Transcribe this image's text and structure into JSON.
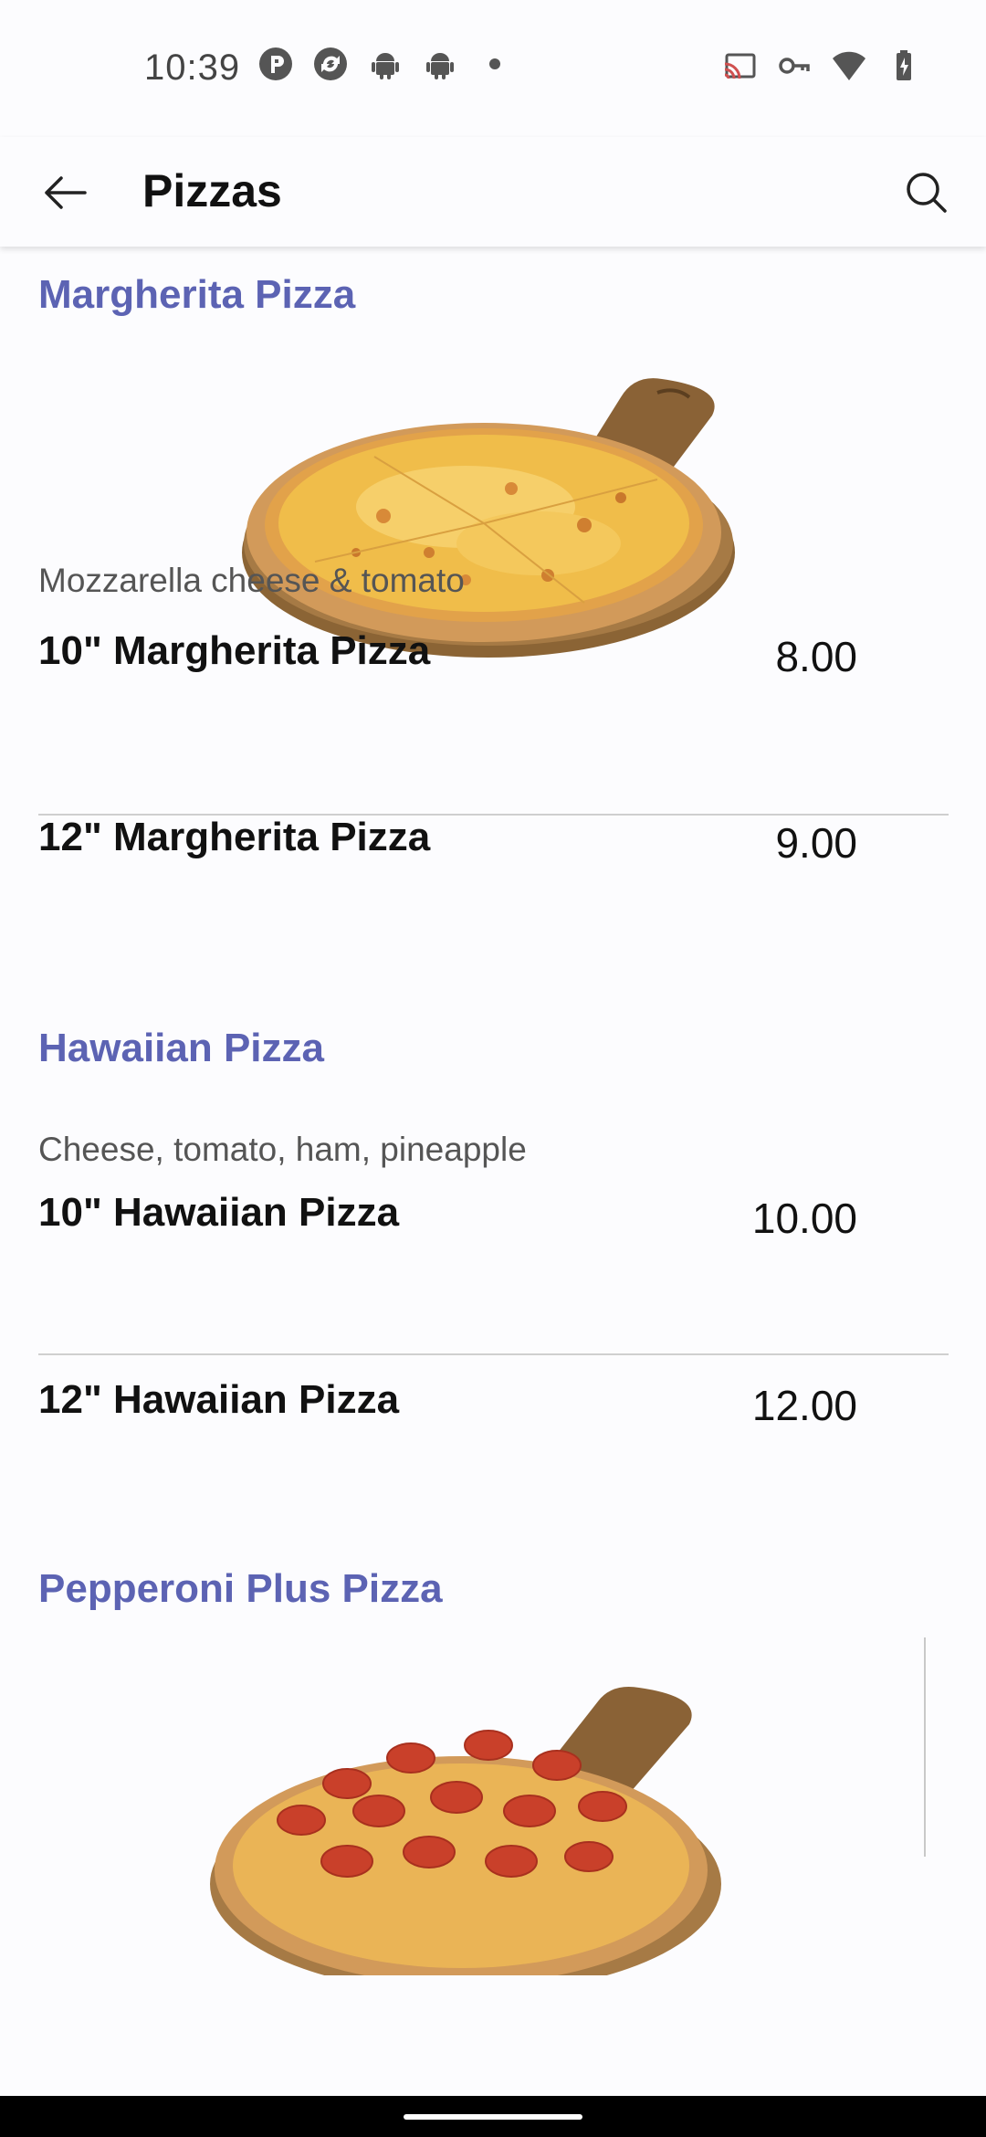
{
  "status_bar": {
    "time": "10:39",
    "left_icons": [
      "app-p-icon",
      "sync-app-icon",
      "android-icon",
      "android-icon",
      "dot-icon"
    ],
    "right_icons": [
      "cast-icon",
      "key-icon",
      "wifi-icon",
      "battery-charging-icon"
    ]
  },
  "app_bar": {
    "title": "Pizzas",
    "back_icon": "arrow-left-icon",
    "search_icon": "search-icon"
  },
  "sections": [
    {
      "title": "Margherita Pizza",
      "description": "Mozzarella cheese & tomato",
      "items": [
        {
          "name": "10\" Margherita Pizza",
          "price": "8.00"
        },
        {
          "name": "12\" Margherita Pizza",
          "price": "9.00"
        }
      ]
    },
    {
      "title": "Hawaiian Pizza",
      "description": "Cheese, tomato, ham, pineapple",
      "items": [
        {
          "name": "10\" Hawaiian Pizza",
          "price": "10.00"
        },
        {
          "name": "12\" Hawaiian Pizza",
          "price": "12.00"
        }
      ]
    },
    {
      "title": "Pepperoni Plus Pizza"
    }
  ],
  "colors": {
    "accent": "#5c63b3",
    "background": "#fcfcfe",
    "divider": "#cfcfcf"
  }
}
